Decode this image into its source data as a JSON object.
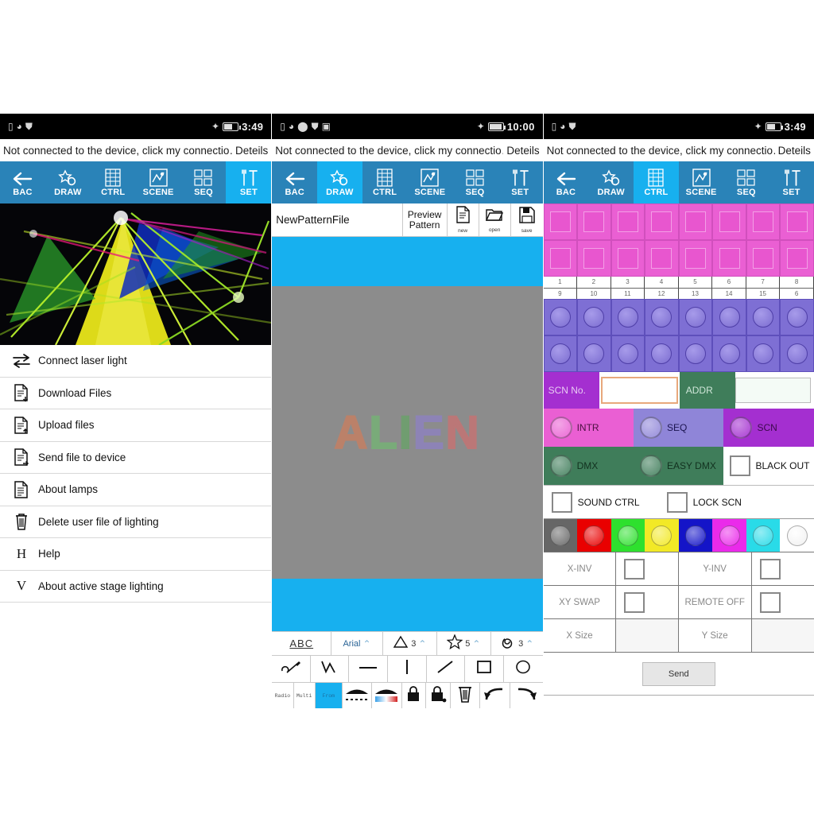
{
  "app": {
    "notice_text": "Not connected to the device, click my connectio…",
    "details_label": "Deteils"
  },
  "status_bars": [
    {
      "time": "3:49",
      "icons": [
        "sim-icon",
        "wifi-icon",
        "shield-icon"
      ],
      "right_icons": [
        "bluetooth-icon",
        "battery-icon"
      ]
    },
    {
      "time": "10:00",
      "icons": [
        "lock-icon",
        "wifi-icon",
        "location-icon",
        "shield-icon",
        "sd-icon"
      ],
      "right_icons": [
        "bluetooth-icon",
        "battery-icon"
      ]
    },
    {
      "time": "3:49",
      "icons": [
        "sim-icon",
        "wifi-icon",
        "shield-icon"
      ],
      "right_icons": [
        "bluetooth-icon",
        "battery-icon"
      ]
    }
  ],
  "nav": {
    "items": [
      {
        "label": "BAC",
        "icon": "back-arrow-icon"
      },
      {
        "label": "DRAW",
        "icon": "star-circle-icon"
      },
      {
        "label": "CTRL",
        "icon": "grid-icon"
      },
      {
        "label": "SCENE",
        "icon": "scene-icon"
      },
      {
        "label": "SEQ",
        "icon": "sequence-icon"
      },
      {
        "label": "SET",
        "icon": "tools-icon"
      }
    ],
    "active_index": [
      5,
      1,
      2
    ]
  },
  "panel_left": {
    "hero_alt": "laser-light-show-photo",
    "menu": [
      {
        "label": "Connect laser light",
        "icon": "exchange-arrows-icon"
      },
      {
        "label": "Download Files",
        "icon": "file-download-icon"
      },
      {
        "label": "Upload files",
        "icon": "file-upload-icon"
      },
      {
        "label": "Send file to device",
        "icon": "file-send-icon"
      },
      {
        "label": "About lamps",
        "icon": "file-info-icon"
      },
      {
        "label": "Delete user file of lighting",
        "icon": "trash-icon"
      },
      {
        "label": "Help",
        "icon": "letter-h-icon",
        "letter": "H"
      },
      {
        "label": "About active stage lighting",
        "icon": "letter-v-icon",
        "letter": "V"
      }
    ]
  },
  "panel_middle": {
    "file_name": "NewPatternFile",
    "preview_label_line1": "Preview",
    "preview_label_line2": "Pattern",
    "actions": [
      {
        "label": "new",
        "icon": "new-file-icon"
      },
      {
        "label": "open",
        "icon": "open-folder-icon"
      },
      {
        "label": "save",
        "icon": "floppy-save-icon"
      }
    ],
    "canvas_text": "ALIEN",
    "canvas_letters": [
      {
        "char": "A",
        "color": "#d97b55"
      },
      {
        "char": "L",
        "color": "#6fbf6f"
      },
      {
        "char": "I",
        "color": "#5fa85f"
      },
      {
        "char": "E",
        "color": "#8f7fd0"
      },
      {
        "char": "N",
        "color": "#d96b6b"
      }
    ],
    "toolbar_row1": [
      {
        "label": "ABC",
        "name": "text-tool"
      },
      {
        "label": "Arial",
        "name": "font-select",
        "caret": "⌃"
      },
      {
        "icon": "triangle-icon",
        "label": "3",
        "name": "polygon-sides",
        "caret": "⌃"
      },
      {
        "icon": "star-icon",
        "label": "5",
        "name": "star-points",
        "caret": "⌃"
      },
      {
        "icon": "spiral-icon",
        "label": "3",
        "name": "spiral-turns",
        "caret": "⌃"
      }
    ],
    "toolbar_row2": [
      {
        "icon": "pen-icon",
        "name": "pen-tool"
      },
      {
        "icon": "polyline-icon",
        "name": "polyline-tool"
      },
      {
        "icon": "horizontal-line-icon",
        "name": "horizontal-line-tool"
      },
      {
        "icon": "vertical-line-icon",
        "name": "vertical-line-tool"
      },
      {
        "icon": "diagonal-line-icon",
        "name": "diagonal-line-tool"
      },
      {
        "icon": "square-icon",
        "name": "rectangle-tool"
      },
      {
        "icon": "circle-icon",
        "name": "ellipse-tool"
      }
    ],
    "toolbar_row3": [
      {
        "label": "Radio",
        "name": "radio-mode"
      },
      {
        "label": "Multi",
        "name": "multi-mode"
      },
      {
        "label": "From",
        "name": "from-mode",
        "selected": true
      },
      {
        "icon": "dashed-gradient-icon",
        "name": "dashed-style"
      },
      {
        "icon": "color-gradient-icon",
        "name": "gradient-style"
      },
      {
        "icon": "lock-icon",
        "name": "lock-button"
      },
      {
        "icon": "unlock-icon",
        "name": "unlock-button"
      },
      {
        "icon": "trash-icon",
        "name": "delete-button"
      },
      {
        "icon": "undo-icon",
        "name": "undo-button"
      },
      {
        "icon": "redo-icon",
        "name": "redo-button"
      }
    ]
  },
  "panel_right": {
    "pad_numbers_row1": [
      "1",
      "2",
      "3",
      "4",
      "5",
      "6",
      "7",
      "8"
    ],
    "pad_numbers_row2": [
      "9",
      "10",
      "11",
      "12",
      "13",
      "14",
      "15",
      "6"
    ],
    "scn_label": "SCN No.",
    "scn_value": "",
    "addr_label": "ADDR",
    "addr_value": "",
    "mode_buttons": [
      {
        "label": "INTR",
        "style": "intr"
      },
      {
        "label": "SEQ",
        "style": "seq"
      },
      {
        "label": "SCN",
        "style": "scn"
      },
      {
        "label": "DMX",
        "style": "dmx"
      },
      {
        "label": "EASY DMX",
        "style": "easy"
      }
    ],
    "black_out_label": "BLACK OUT",
    "checkboxes": [
      {
        "label": "SOUND CTRL"
      },
      {
        "label": "LOCK SCN"
      }
    ],
    "colors": [
      "#666666",
      "#e90000",
      "#2ee02e",
      "#f2e926",
      "#1414c8",
      "#ea2aea",
      "#29dbe8",
      "#ffffff"
    ],
    "settings": [
      {
        "label": "X-INV",
        "type": "checkbox"
      },
      {
        "label": "Y-INV",
        "type": "checkbox"
      },
      {
        "label": "XY SWAP",
        "type": "checkbox"
      },
      {
        "label": "REMOTE OFF",
        "type": "checkbox"
      },
      {
        "label": "X Size",
        "type": "field",
        "value": ""
      },
      {
        "label": "Y Size",
        "type": "field",
        "value": ""
      }
    ],
    "send_label": "Send"
  },
  "theme": {
    "nav_bg": "#2a83b8",
    "nav_active": "#17b0ef",
    "pad_pink": "#ea5fd3",
    "knob_purple": "#7e6fd4",
    "green": "#3f7d5a",
    "purple": "#a42fd0"
  }
}
